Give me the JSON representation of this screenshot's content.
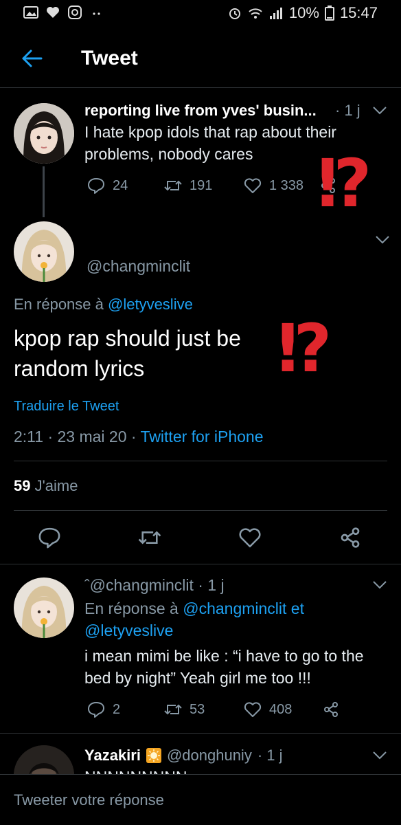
{
  "status_bar": {
    "battery": "10%",
    "time": "15:47"
  },
  "header": {
    "title": "Tweet"
  },
  "parent_tweet": {
    "display_name": "reporting live from yves' busin...",
    "time_ago": "· 1 j",
    "text_line1": "I hate kpop idols that rap about their",
    "text_line2": "problems, nobody cares",
    "replies": "24",
    "retweets": "191",
    "likes": "1 338"
  },
  "overlay_mark": "⁉",
  "main_tweet": {
    "handle": "@changminclit",
    "reply_prefix": "En réponse à",
    "reply_to": "@letyveslive",
    "text_line1": "kpop rap should just be",
    "text_line2": "random lyrics",
    "translate_label": "Traduire le Tweet",
    "timestamp": "2:11 · 23 mai 20 ·",
    "source": "Twitter for iPhone",
    "likes_count": "59",
    "likes_label": "J'aime"
  },
  "reply_tweet": {
    "handle_line": "ˆ@changminclit · 1 j",
    "reply_prefix": "En réponse à",
    "reply_to_1": "@changminclit et",
    "reply_to_2": "@letyveslive",
    "text_line1": "i mean mimi be like : “i have to go to the",
    "text_line2": "bed by night” Yeah girl me too !!!",
    "replies": "2",
    "retweets": "53",
    "likes": "408"
  },
  "next_tweet": {
    "display_name": "Yazakiri",
    "handle": "@donghuniy",
    "time_ago": "· 1 j",
    "partial_text": "NNNNNNNNN"
  },
  "reply_composer": {
    "placeholder": "Tweeter votre réponse"
  },
  "colors": {
    "background": "#000000",
    "accent": "#1da1f2",
    "muted": "#8899a6",
    "overlay_red": "#e0262c"
  }
}
